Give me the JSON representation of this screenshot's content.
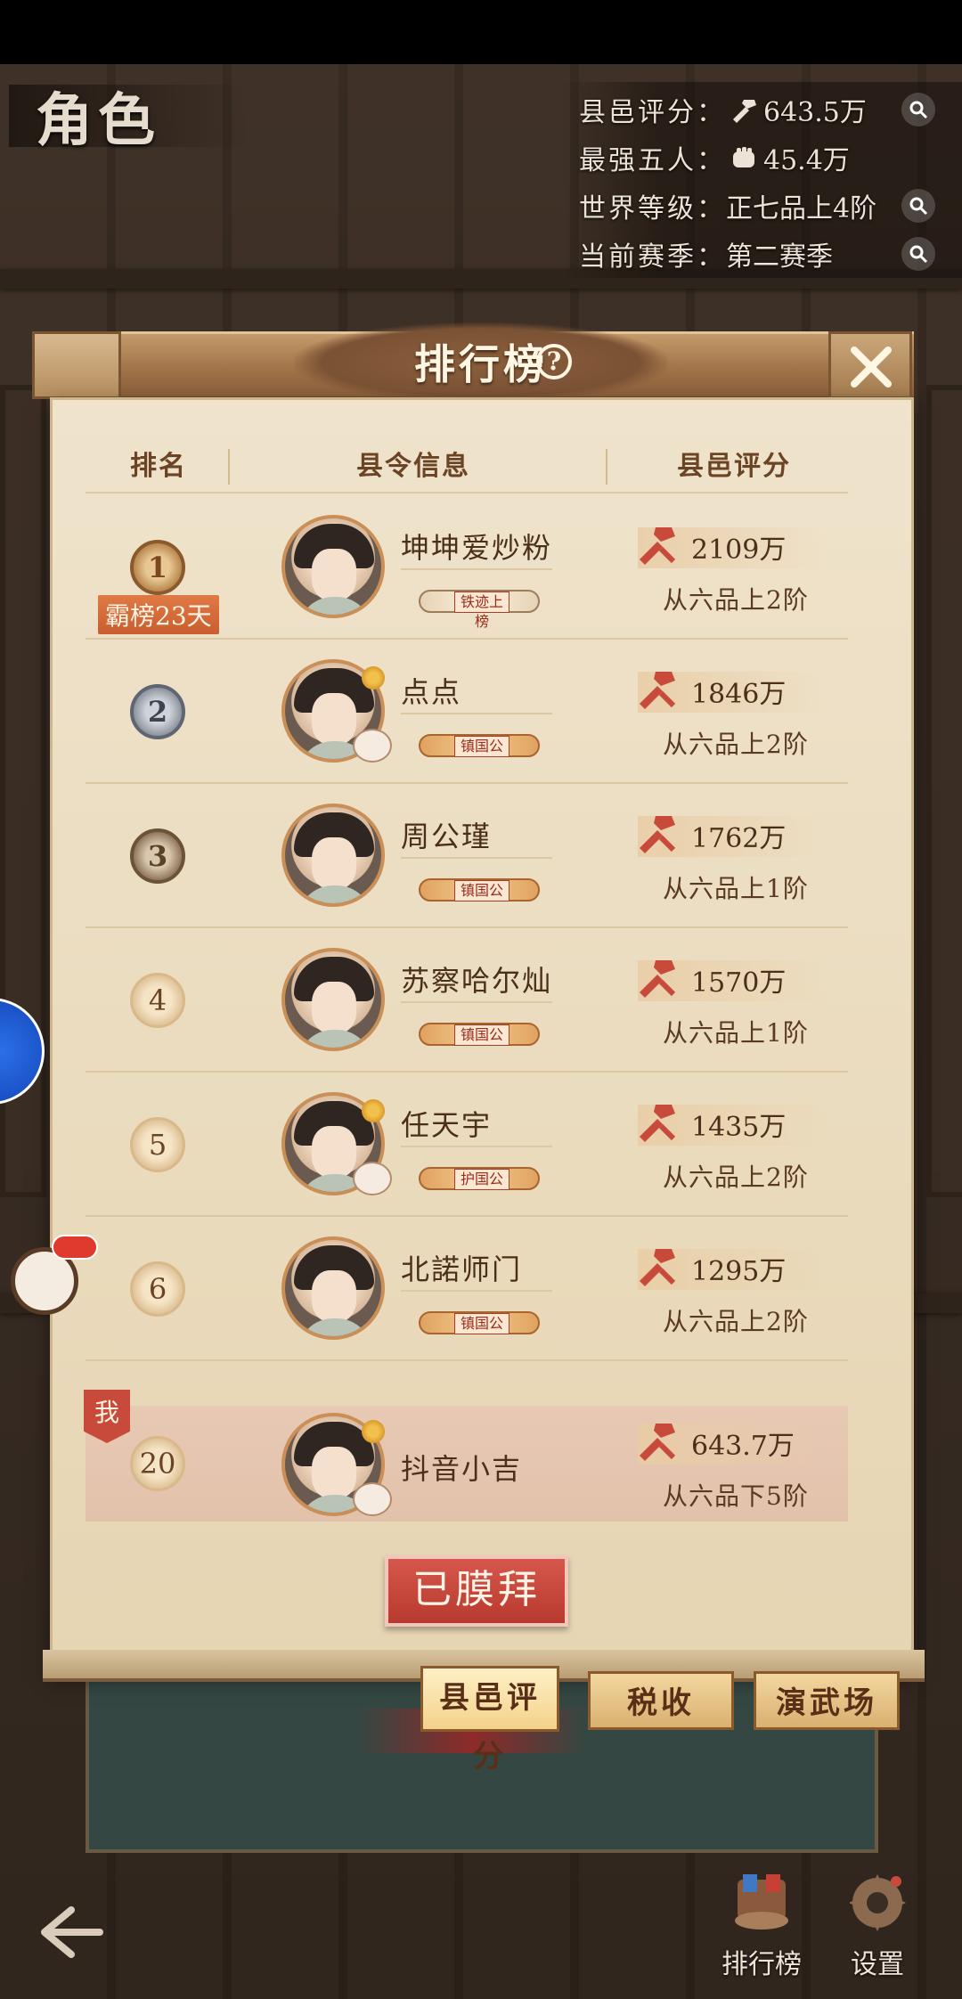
{
  "header": {
    "corner_title": "角色",
    "stats": [
      {
        "label": "县邑评分：",
        "value": "643.5万",
        "icon": "hammer-icon",
        "search": true
      },
      {
        "label": "最强五人：",
        "value": "45.4万",
        "icon": "fist-icon",
        "search": false
      },
      {
        "label": "世界等级：",
        "value": "正七品上4阶",
        "icon": "",
        "search": true
      },
      {
        "label": "当前赛季：",
        "value": "第二赛季",
        "icon": "",
        "search": true
      }
    ]
  },
  "modal": {
    "title": "排行榜",
    "columns": {
      "rank": "排名",
      "info": "县令信息",
      "score": "县邑评分"
    },
    "rows": [
      {
        "rank": "1",
        "name": "坤坤爱炒粉",
        "badge": "铁迹上榜",
        "score": "2109万",
        "grade": "从六品上2阶",
        "streak": "霸榜23天"
      },
      {
        "rank": "2",
        "name": "点点",
        "badge": "镇国公",
        "score": "1846万",
        "grade": "从六品上2阶"
      },
      {
        "rank": "3",
        "name": "周公瑾",
        "badge": "镇国公",
        "score": "1762万",
        "grade": "从六品上1阶"
      },
      {
        "rank": "4",
        "name": "苏察哈尔灿",
        "badge": "镇国公",
        "score": "1570万",
        "grade": "从六品上1阶"
      },
      {
        "rank": "5",
        "name": "任天宇",
        "badge": "护国公",
        "score": "1435万",
        "grade": "从六品上2阶"
      },
      {
        "rank": "6",
        "name": "北諾师门",
        "badge": "镇国公",
        "score": "1295万",
        "grade": "从六品上2阶"
      }
    ],
    "me": {
      "tag": "我",
      "rank": "20",
      "name": "抖音小吉",
      "score": "643.7万",
      "grade": "从六品下5阶"
    },
    "worship_button": "已膜拜",
    "tabs": [
      "县邑评分",
      "税收",
      "演武场"
    ]
  },
  "bottom": {
    "leaderboard_label": "排行榜",
    "settings_label": "设置"
  },
  "colors": {
    "accent_red": "#c84a3a",
    "paper": "#efe3cc",
    "brown_text": "#4b2f1a"
  }
}
